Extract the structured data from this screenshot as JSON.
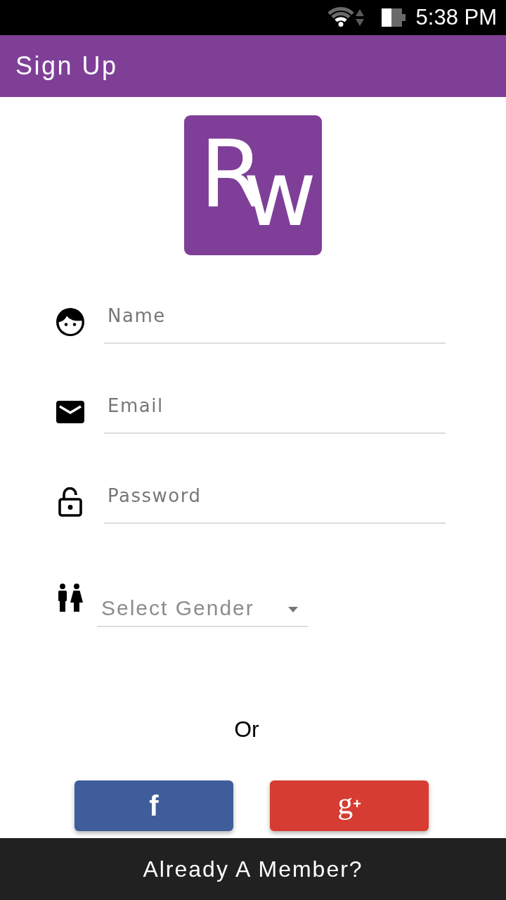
{
  "status_bar": {
    "time": "5:38 PM"
  },
  "app_bar": {
    "title": "Sign Up"
  },
  "logo": {
    "letters": [
      "R",
      "w"
    ]
  },
  "fields": [
    {
      "kind": "name",
      "placeholder": "Name"
    },
    {
      "kind": "email",
      "placeholder": "Email"
    },
    {
      "kind": "password",
      "placeholder": "Password"
    }
  ],
  "gender_select": {
    "placeholder": "Select Gender"
  },
  "divider": {
    "text": "Or"
  },
  "social_buttons": [
    {
      "kind": "facebook",
      "label": "f"
    },
    {
      "kind": "google",
      "label": "g$^{+}$"
    }
  ],
  "footer": {
    "label": "Already A Member?"
  }
}
